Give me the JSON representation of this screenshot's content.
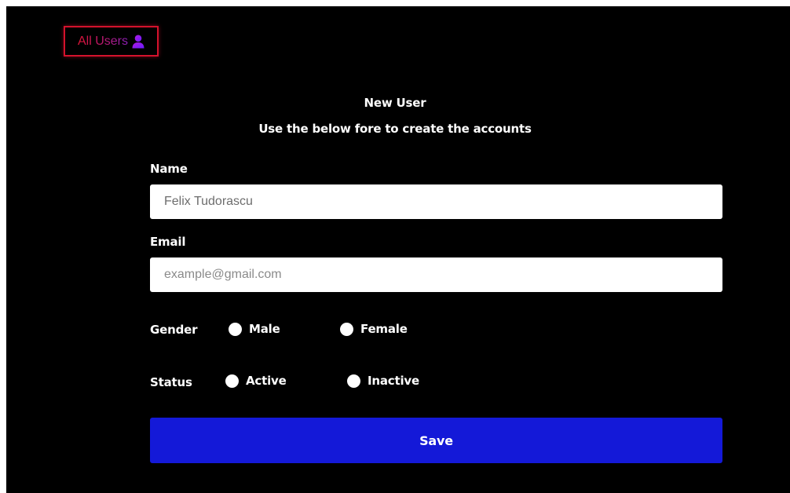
{
  "nav": {
    "all_users_label": "All Users",
    "all_users_icon": "user-icon"
  },
  "form": {
    "title": "New User",
    "subtitle": "Use the below fore to create the accounts",
    "name": {
      "label": "Name",
      "value": "Felix Tudorascu"
    },
    "email": {
      "label": "Email",
      "placeholder": "example@gmail.com"
    },
    "gender": {
      "label": "Gender",
      "options": [
        "Male",
        "Female"
      ]
    },
    "status": {
      "label": "Status",
      "options": [
        "Active",
        "Inactive"
      ]
    },
    "save_label": "Save"
  },
  "colors": {
    "background": "#000000",
    "accent_red": "#d4122c",
    "accent_purple": "#8a1fb8",
    "save_button": "#1419d8",
    "input_background": "#ffffff"
  }
}
